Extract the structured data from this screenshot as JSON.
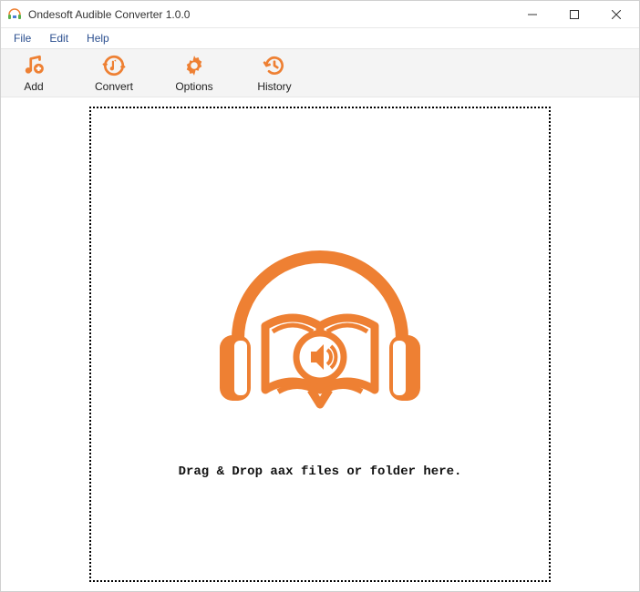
{
  "window": {
    "title": "Ondesoft Audible Converter 1.0.0"
  },
  "menu": {
    "items": [
      {
        "label": "File"
      },
      {
        "label": "Edit"
      },
      {
        "label": "Help"
      }
    ]
  },
  "toolbar": {
    "add": "Add",
    "convert": "Convert",
    "options": "Options",
    "history": "History"
  },
  "dropzone": {
    "message": "Drag & Drop aax files or folder here."
  },
  "colors": {
    "accent": "#ee8033"
  }
}
